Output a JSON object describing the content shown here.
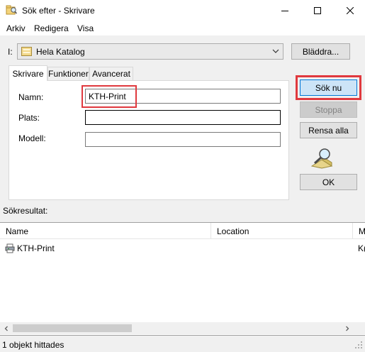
{
  "window": {
    "title": "Sök efter - Skrivare",
    "controls": [
      "minimize-icon",
      "maximize-icon",
      "close-icon"
    ]
  },
  "menu": {
    "items": [
      "Arkiv",
      "Redigera",
      "Visa"
    ]
  },
  "location": {
    "label": "I:",
    "value": "Hela Katalog",
    "icon": "directory-icon",
    "browse_label": "Bläddra..."
  },
  "tabs": [
    {
      "label": "Skrivare",
      "selected": true
    },
    {
      "label": "Funktioner",
      "selected": false
    },
    {
      "label": "Avancerat",
      "selected": false
    }
  ],
  "form": {
    "name_label": "Namn:",
    "name_value": "KTH-Print",
    "location_label": "Plats:",
    "location_value": "",
    "model_label": "Modell:",
    "model_value": ""
  },
  "actions": {
    "search_label": "Sök nu",
    "stop_label": "Stoppa",
    "clear_label": "Rensa alla",
    "ok_label": "OK"
  },
  "results": {
    "label": "Sökresultat:",
    "columns": [
      "Name",
      "Location",
      "M"
    ],
    "rows": [
      {
        "name": "KTH-Print",
        "location": "",
        "model": "K("
      }
    ]
  },
  "status": {
    "text": "1 objekt hittades"
  },
  "colors": {
    "highlight": "#e0393e",
    "focus_button": "#cce4f7",
    "focus_border": "#0078d7"
  }
}
